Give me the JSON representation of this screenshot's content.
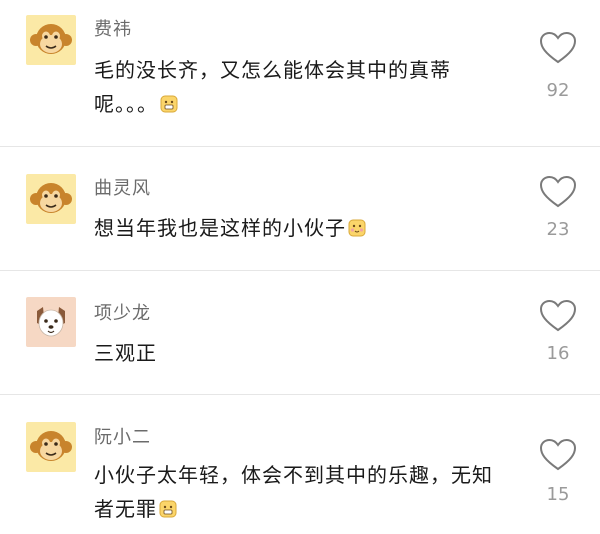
{
  "comments": [
    {
      "name": "费祎",
      "text": "毛的没长齐，又怎么能体会其中的真蒂呢。。。",
      "likes": "92",
      "avatar": "monkey-avatar"
    },
    {
      "name": "曲灵风",
      "text": "想当年我也是这样的小伙子",
      "likes": "23",
      "avatar": "monkey-avatar"
    },
    {
      "name": "项少龙",
      "text": "三观正",
      "likes": "16",
      "avatar": "dog-avatar"
    },
    {
      "name": "阮小二",
      "text": "小伙子太年轻，体会不到其中的乐趣，无知者无罪",
      "likes": "15",
      "avatar": "monkey-avatar"
    }
  ],
  "colors": {
    "name": "#6b6b6b",
    "text": "#1a1a1a",
    "count": "#9a9a9a",
    "avatar_bg": "#fbe9a6",
    "dog_bg": "#f6d8c4"
  }
}
